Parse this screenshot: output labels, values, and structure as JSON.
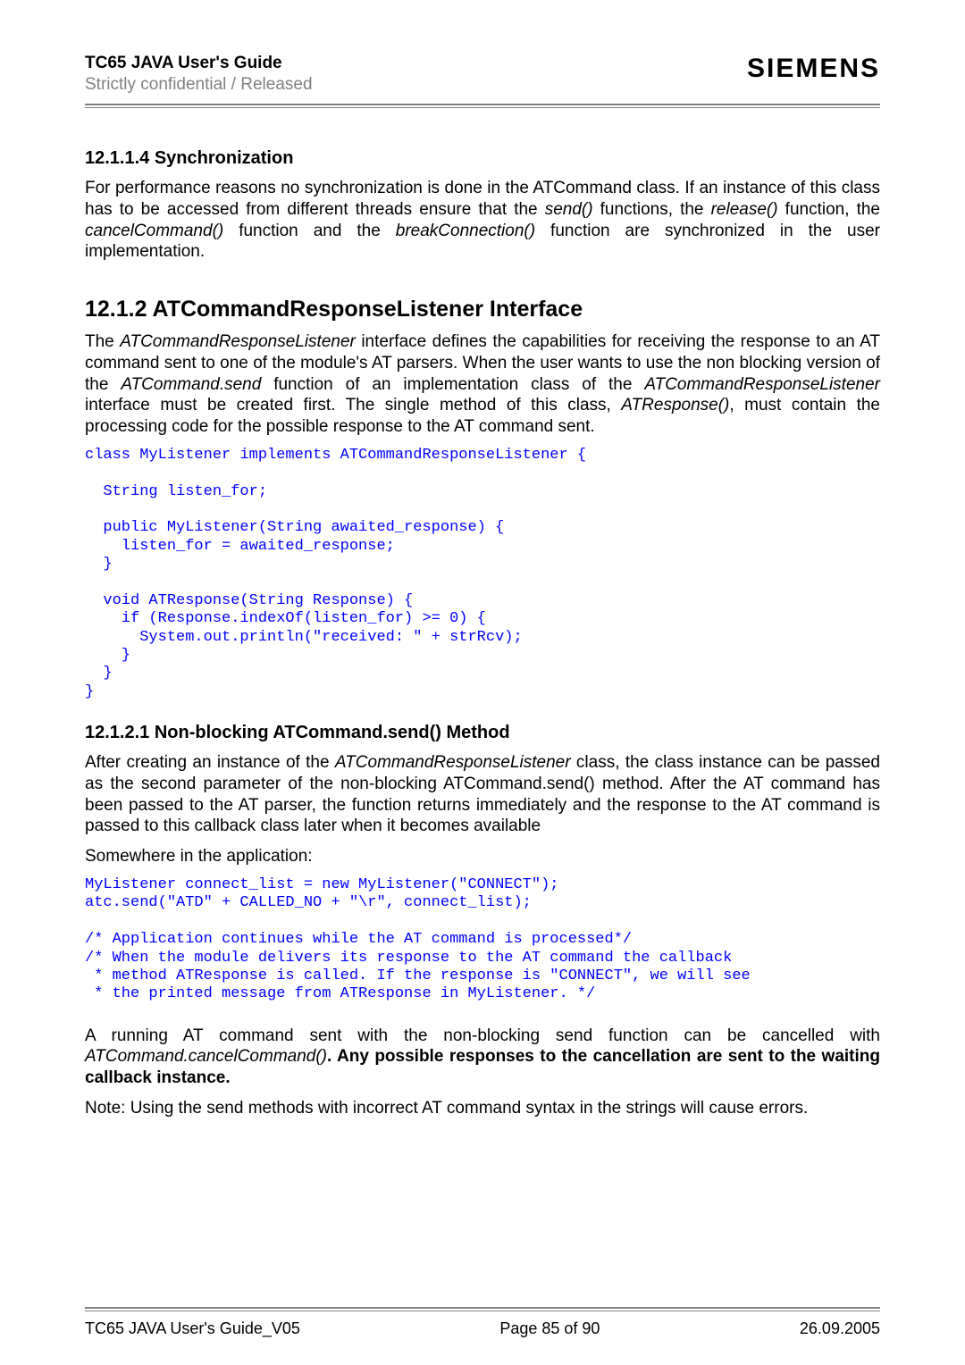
{
  "header": {
    "title": "TC65 JAVA User's Guide",
    "subtitle": "Strictly confidential / Released",
    "brand": "SIEMENS"
  },
  "sec_12_1_1_4": {
    "heading": "12.1.1.4   Synchronization",
    "para_before": "For performance reasons no synchronization is done in the ATCommand class. If an instance of this class has to be accessed from different threads ensure that the ",
    "i1": "send()",
    "mid1": " functions, the ",
    "i2": "release()",
    "mid2": " function, the ",
    "i3": "cancelCommand()",
    "mid3": " function and the ",
    "i4": "breakConnection()",
    "after": " function are synchronized in the user implementation."
  },
  "sec_12_1_2": {
    "heading": "12.1.2    ATCommandResponseListener Interface",
    "p1a": "The ",
    "p1i1": "ATCommandResponseListener",
    "p1b": " interface defines the capabilities for receiving the response to an AT command sent to one of the module's AT parsers. When the user wants to use the non blocking version of the ",
    "p1i2": "ATCommand.send",
    "p1c": " function of an implementation class of the ",
    "p1i3": "ATCommandResponseListener",
    "p1d": " interface must be created first. The single method of this class, ",
    "p1i4": "ATResponse()",
    "p1e": ", must contain the processing code for the possible response to the AT command sent.",
    "code": "class MyListener implements ATCommandResponseListener {\n\n  String listen_for;\n\n  public MyListener(String awaited_response) {\n    listen_for = awaited_response;\n  }\n\n  void ATResponse(String Response) {\n    if (Response.indexOf(listen_for) >= 0) {\n      System.out.println(\"received: \" + strRcv);\n    }\n  }\n}"
  },
  "sec_12_1_2_1": {
    "heading": "12.1.2.1   Non-blocking ATCommand.send() Method",
    "p1a": "After creating an instance of the ",
    "p1i1": "ATCommandResponseListener",
    "p1b": " class, the class instance can be passed as the second parameter of the non-blocking ATCommand.send() method. After the AT command has been passed to the AT parser, the function returns immediately and the response to the AT command is passed to this callback class later when it becomes available",
    "p2": "Somewhere in the application:",
    "code": "MyListener connect_list = new MyListener(\"CONNECT\");\natc.send(\"ATD\" + CALLED_NO + \"\\r\", connect_list);\n\n/* Application continues while the AT command is processed*/\n/* When the module delivers its response to the AT command the callback\n * method ATResponse is called. If the response is \"CONNECT\", we will see\n * the printed message from ATResponse in MyListener. */",
    "p3a": "A running AT command sent with the non-blocking send function can be cancelled with ",
    "p3i1": "ATCommand.cancelCommand()",
    "p3b": ". Any possible responses to the cancellation are sent to the waiting callback instance.",
    "p4": "Note: Using the send methods with incorrect AT command syntax in the strings will cause errors."
  },
  "footer": {
    "left": "TC65 JAVA User's Guide_V05",
    "center": "Page 85 of 90",
    "right": "26.09.2005"
  }
}
